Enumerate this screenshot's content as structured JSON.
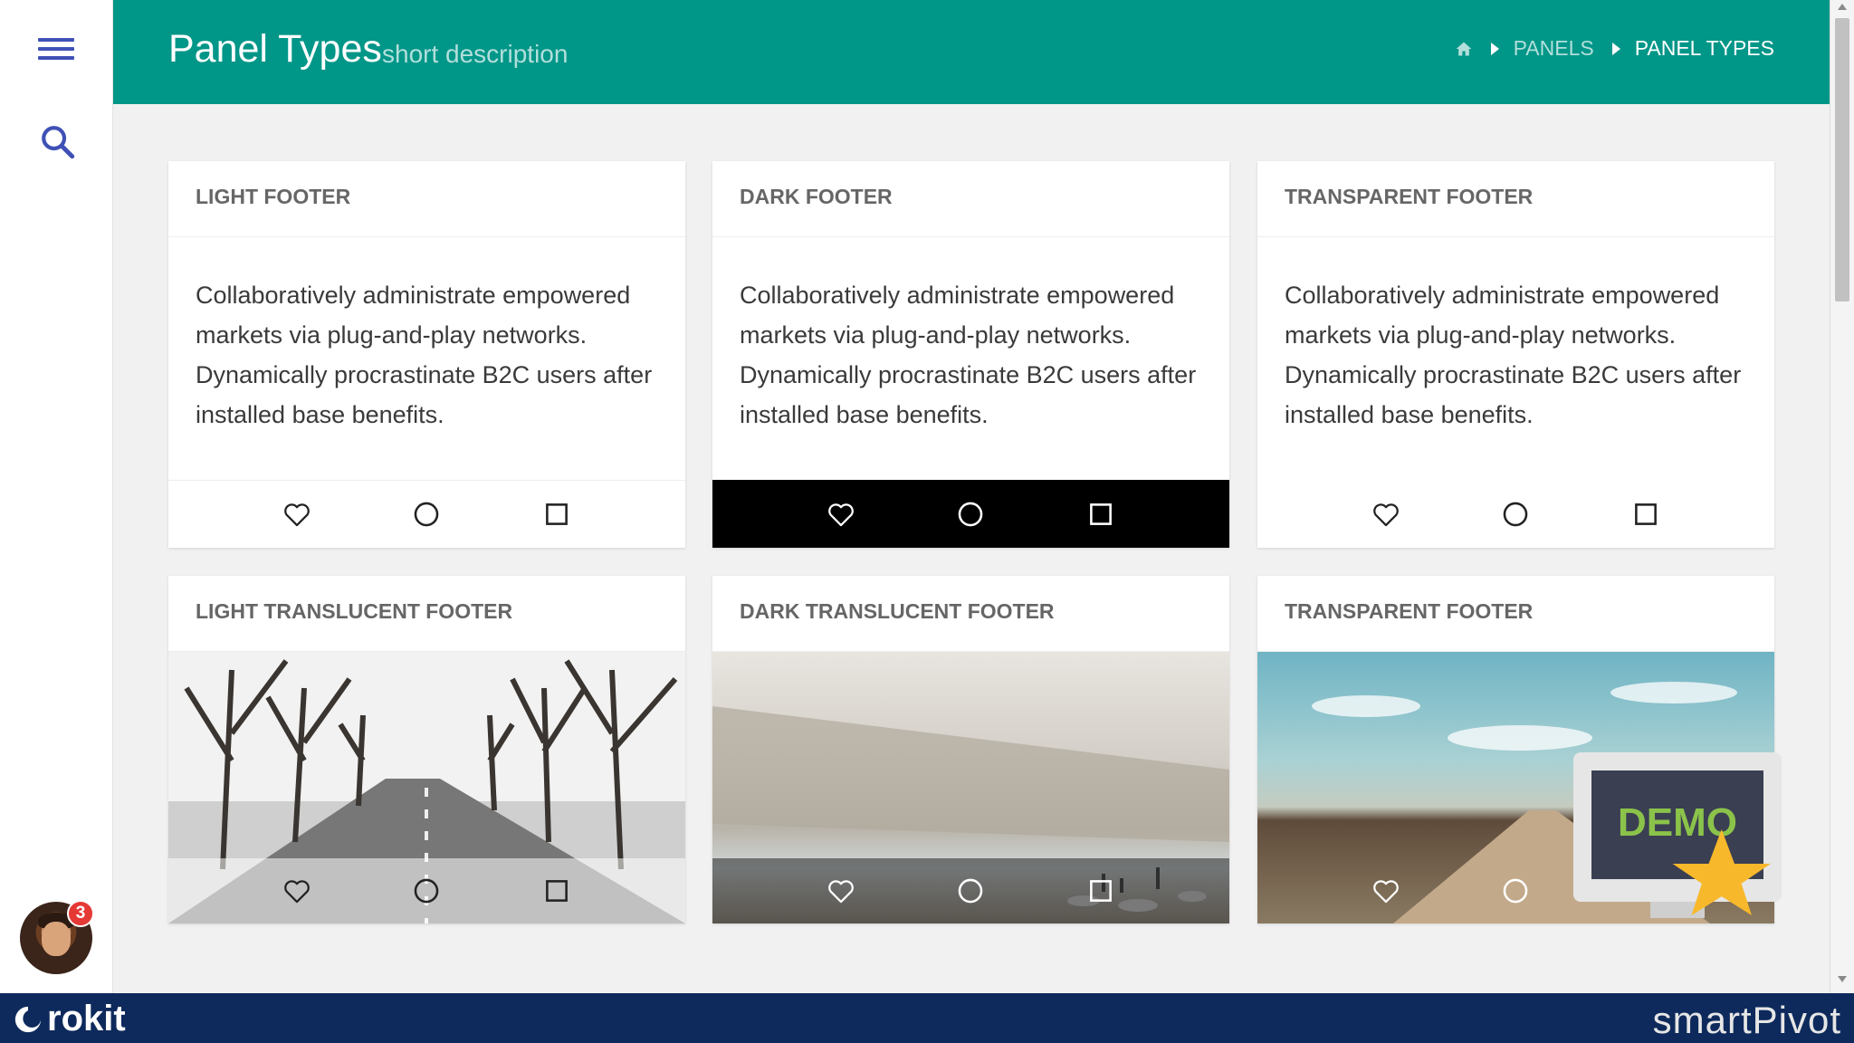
{
  "header": {
    "title": "Panel Types",
    "subtitle": "short description",
    "breadcrumb": [
      "PANELS",
      "PANEL TYPES"
    ],
    "bg_color": "#009688"
  },
  "sidebar": {
    "notification_count": "3"
  },
  "cards": [
    {
      "title": "LIGHT FOOTER",
      "body": "Collaboratively administrate empowered markets via plug-and-play networks. Dynamically procrastinate B2C users after installed base benefits.",
      "footer": "light"
    },
    {
      "title": "DARK FOOTER",
      "body": "Collaboratively administrate empowered markets via plug-and-play networks. Dynamically procrastinate B2C users after installed base benefits.",
      "footer": "dark"
    },
    {
      "title": "TRANSPARENT FOOTER",
      "body": "Collaboratively administrate empowered markets via plug-and-play networks. Dynamically procrastinate B2C users after installed base benefits.",
      "footer": "transparent"
    },
    {
      "title": "LIGHT TRANSLUCENT FOOTER",
      "footer": "light-translucent"
    },
    {
      "title": "DARK TRANSLUCENT FOOTER",
      "footer": "dark-translucent"
    },
    {
      "title": "TRANSPARENT FOOTER",
      "footer": "transparent"
    }
  ],
  "footer_icons": [
    "heart-icon",
    "circle-icon",
    "square-icon"
  ],
  "demo_badge": "DEMO",
  "bottom_bar": {
    "left_brand": "rokit",
    "right_brand": "smartPivot"
  }
}
